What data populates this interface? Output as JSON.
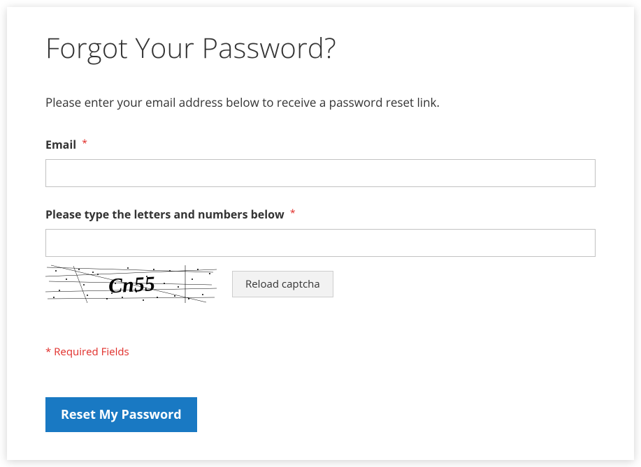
{
  "header": {
    "title": "Forgot Your Password?"
  },
  "instruction_text": "Please enter your email address below to receive a password reset link.",
  "fields": {
    "email": {
      "label": "Email",
      "value": ""
    },
    "captcha": {
      "label": "Please type the letters and numbers below",
      "value": "",
      "image_text": "Cn55",
      "reload_label": "Reload captcha"
    }
  },
  "required_note": "* Required Fields",
  "submit": {
    "label": "Reset My Password"
  },
  "colors": {
    "primary": "#1979c3",
    "error": "#e02b27",
    "border": "#c2c2c2",
    "text": "#333333"
  }
}
